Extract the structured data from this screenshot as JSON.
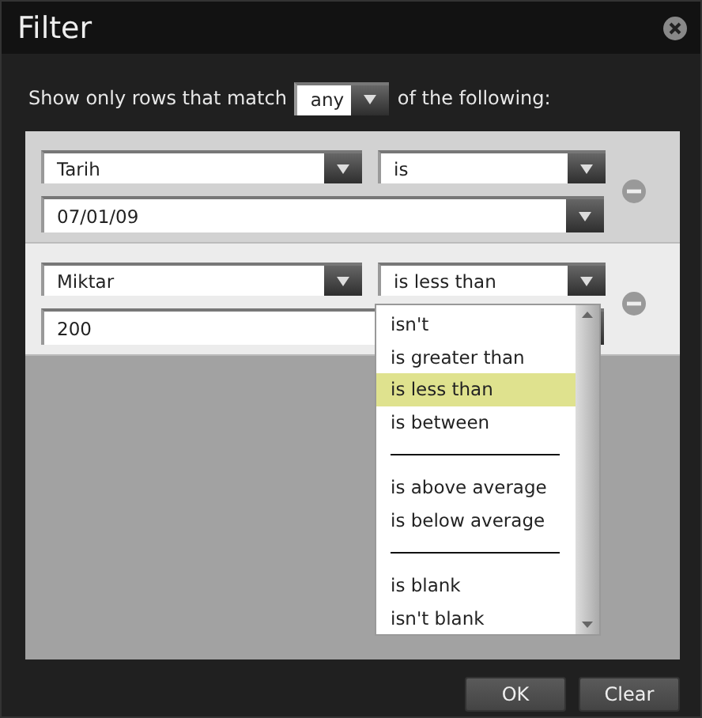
{
  "window": {
    "title": "Filter"
  },
  "match": {
    "prefix": "Show only rows that match",
    "value": "any",
    "suffix": "of the following:"
  },
  "rules": [
    {
      "field": "Tarih",
      "operator": "is",
      "value": "07/01/09",
      "selected": false
    },
    {
      "field": "Miktar",
      "operator": "is less than",
      "value": "200",
      "selected": true
    }
  ],
  "operator_menu": {
    "items": [
      {
        "kind": "option",
        "label": "isn't",
        "selected": false
      },
      {
        "kind": "option",
        "label": "is greater than",
        "selected": false
      },
      {
        "kind": "option",
        "label": "is less than",
        "selected": true
      },
      {
        "kind": "option",
        "label": "is between",
        "selected": false
      },
      {
        "kind": "separator"
      },
      {
        "kind": "option",
        "label": "is above average",
        "selected": false
      },
      {
        "kind": "option",
        "label": "is below average",
        "selected": false
      },
      {
        "kind": "separator"
      },
      {
        "kind": "option",
        "label": "is blank",
        "selected": false
      },
      {
        "kind": "option",
        "label": "isn't blank",
        "selected": false
      }
    ]
  },
  "buttons": [
    "OK",
    "Clear"
  ]
}
